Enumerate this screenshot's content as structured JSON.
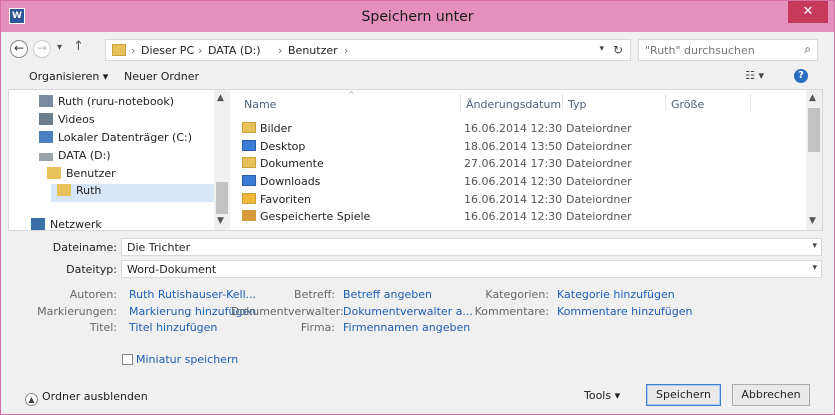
{
  "window": {
    "title": "Speichern unter",
    "app_icon": "word-icon",
    "close_glyph": "✕"
  },
  "nav": {
    "back_glyph": "←",
    "forward_glyph": "→",
    "history_glyph": "▾",
    "up_glyph": "↑"
  },
  "address": {
    "crumbs": [
      "Dieser PC",
      "DATA (D:)",
      "Benutzer"
    ],
    "separator": "›"
  },
  "search": {
    "placeholder": "\"Ruth\" durchsuchen"
  },
  "toolbar": {
    "organize_label": "Organisieren ▾",
    "new_folder_label": "Neuer Ordner",
    "view_glyph": "☷ ▾",
    "help_glyph": "?"
  },
  "navpane": {
    "items": [
      {
        "label": "Ruth (ruru-notebook)",
        "icon": "network-computer-icon"
      },
      {
        "label": "Videos",
        "icon": "videos-folder-icon"
      },
      {
        "label": "Lokaler Datenträger (C:)",
        "icon": "windows-drive-icon"
      },
      {
        "label": "DATA (D:)",
        "icon": "drive-icon"
      },
      {
        "label": "Benutzer",
        "icon": "folder-icon"
      },
      {
        "label": "Ruth",
        "icon": "folder-icon"
      },
      {
        "label": "Netzwerk",
        "icon": "network-icon"
      }
    ]
  },
  "files": {
    "columns": [
      "Name",
      "Änderungsdatum",
      "Typ",
      "Größe"
    ],
    "rows": [
      {
        "name": "Bilder",
        "date": "16.06.2014 12:30",
        "type": "Dateiordner"
      },
      {
        "name": "Desktop",
        "date": "18.06.2014 13:50",
        "type": "Dateiordner"
      },
      {
        "name": "Dokumente",
        "date": "27.06.2014 17:30",
        "type": "Dateiordner"
      },
      {
        "name": "Downloads",
        "date": "16.06.2014 12:30",
        "type": "Dateiordner"
      },
      {
        "name": "Favoriten",
        "date": "16.06.2014 12:30",
        "type": "Dateiordner"
      },
      {
        "name": "Gespeicherte Spiele",
        "date": "16.06.2014 12:30",
        "type": "Dateiordner"
      }
    ]
  },
  "form": {
    "filename_label": "Dateiname:",
    "filename_value": "Die Trichter",
    "filetype_label": "Dateityp:",
    "filetype_value": "Word-Dokument"
  },
  "meta": {
    "authors_label": "Autoren:",
    "authors_value": "Ruth Rutishauser-Kell...",
    "tags_label": "Markierungen:",
    "tags_value": "Markierung hinzufügen",
    "title_label": "Titel:",
    "title_value": "Titel hinzufügen",
    "subject_label": "Betreff:",
    "subject_value": "Betreff angeben",
    "manager_label": "Dokumentverwalter:",
    "manager_value": "Dokumentverwalter a...",
    "company_label": "Firma:",
    "company_value": "Firmennamen angeben",
    "categories_label": "Kategorien:",
    "categories_value": "Kategorie hinzufügen",
    "comments_label": "Kommentare:",
    "comments_value": "Kommentare hinzufügen"
  },
  "thumbnail": {
    "label": "Miniatur speichern"
  },
  "footer": {
    "hide_folders_label": "Ordner ausblenden",
    "tools_label": "Tools  ▾",
    "save_label": "Speichern",
    "cancel_label": "Abbrechen"
  }
}
